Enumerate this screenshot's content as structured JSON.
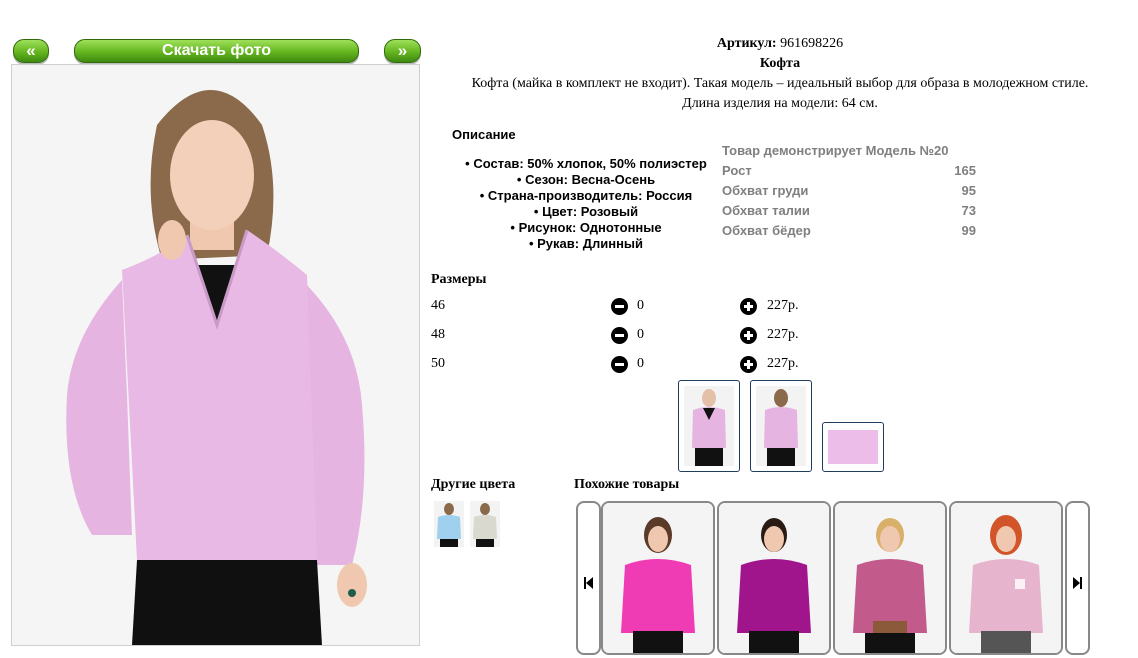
{
  "nav": {
    "prev_label": "«",
    "download_label": "Скачать фото",
    "next_label": "»"
  },
  "product": {
    "article_label": "Артикул:",
    "article_value": "961698226",
    "title": "Кофта",
    "description_line1": "Кофта (майка в комплект не входит). Такая модель – идеальный выбор для образа в молодежном стиле.",
    "description_line2": "Длина изделия на модели: 64 см."
  },
  "specs": {
    "title": "Описание",
    "items": [
      "Состав: 50% хлопок, 50% полиэстер",
      "Сезон: Весна-Осень",
      "Страна-производитель: Россия",
      "Цвет: Розовый",
      "Рисунок: Однотонные",
      "Рукав: Длинный"
    ]
  },
  "model": {
    "title": "Товар демонстрирует Модель №20",
    "rows": [
      {
        "label": "Рост",
        "value": "165"
      },
      {
        "label": "Обхват груди",
        "value": "95"
      },
      {
        "label": "Обхват талии",
        "value": "73"
      },
      {
        "label": "Обхват бёдер",
        "value": "99"
      }
    ]
  },
  "sizes": {
    "title": "Размеры",
    "rows": [
      {
        "size": "46",
        "qty": "0",
        "price": "227р."
      },
      {
        "size": "48",
        "qty": "0",
        "price": "227р."
      },
      {
        "size": "50",
        "qty": "0",
        "price": "227р."
      }
    ]
  },
  "other_colors": {
    "title": "Другие цвета",
    "swatches": [
      "light-blue",
      "light-gray"
    ]
  },
  "similar": {
    "title": "Похожие товары",
    "prev_icon": "skip-previous-icon",
    "next_icon": "skip-next-icon",
    "items": [
      {
        "color": "#f03cb4"
      },
      {
        "color": "#a0148c"
      },
      {
        "color": "#c35a8c"
      },
      {
        "color": "#e6b4cd"
      }
    ]
  },
  "colors": {
    "button_green": "#64b51f",
    "sweater_pink": "#e6b4e1",
    "thumb_border": "#1f3d5c",
    "muted_text": "#7f7f7f"
  }
}
